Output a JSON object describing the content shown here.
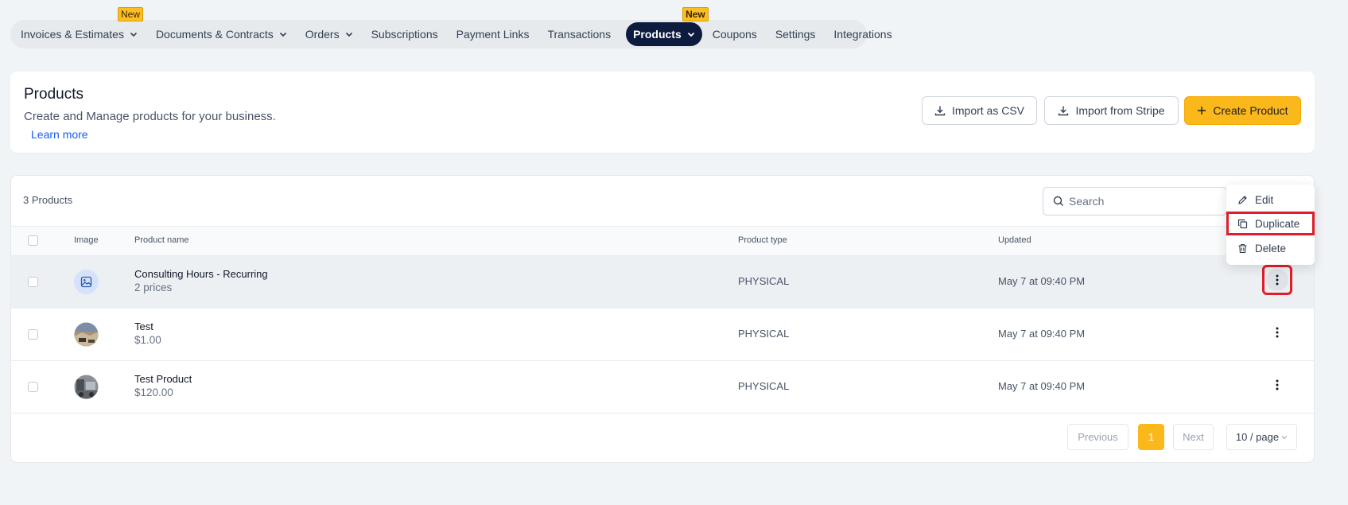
{
  "nav": {
    "items": [
      {
        "label": "Invoices & Estimates",
        "dropdown": true
      },
      {
        "label": "Documents & Contracts",
        "dropdown": true
      },
      {
        "label": "Orders",
        "dropdown": true
      },
      {
        "label": "Subscriptions",
        "dropdown": false
      },
      {
        "label": "Payment Links",
        "dropdown": false
      },
      {
        "label": "Transactions",
        "dropdown": false
      },
      {
        "label": "Products",
        "dropdown": true,
        "active": true
      },
      {
        "label": "Coupons",
        "dropdown": false
      },
      {
        "label": "Settings",
        "dropdown": false
      },
      {
        "label": "Integrations",
        "dropdown": false
      }
    ],
    "new_badge": "New"
  },
  "header": {
    "title": "Products",
    "subtitle": "Create and Manage products for your business.",
    "learn_more": "Learn more",
    "import_csv": "Import as CSV",
    "import_stripe": "Import from Stripe",
    "create_product": "Create Product",
    "create_icon": "plus-icon",
    "import_icon": "download-icon"
  },
  "table": {
    "count": "3 Products",
    "search_placeholder": "Search",
    "columns": {
      "image": "Image",
      "name": "Product name",
      "type": "Product type",
      "updated": "Updated"
    },
    "rows": [
      {
        "name": "Consulting Hours - Recurring",
        "sub": "2 prices",
        "type": "PHYSICAL",
        "updated": "May 7 at 09:40 PM",
        "image": "image-placeholder-icon"
      },
      {
        "name": "Test",
        "sub": "$1.00",
        "type": "PHYSICAL",
        "updated": "May 7 at 09:40 PM",
        "image": "product-photo"
      },
      {
        "name": "Test Product",
        "sub": "$120.00",
        "type": "PHYSICAL",
        "updated": "May 7 at 09:40 PM",
        "image": "product-photo"
      }
    ]
  },
  "pagination": {
    "previous": "Previous",
    "current_page": "1",
    "next": "Next",
    "page_size": "10 / page"
  },
  "menu": {
    "edit": "Edit",
    "duplicate": "Duplicate",
    "delete": "Delete"
  },
  "colors": {
    "accent": "#fbb81a",
    "active_nav": "#0d1b3e",
    "highlight": "#e11d2b",
    "link": "#155eef"
  }
}
